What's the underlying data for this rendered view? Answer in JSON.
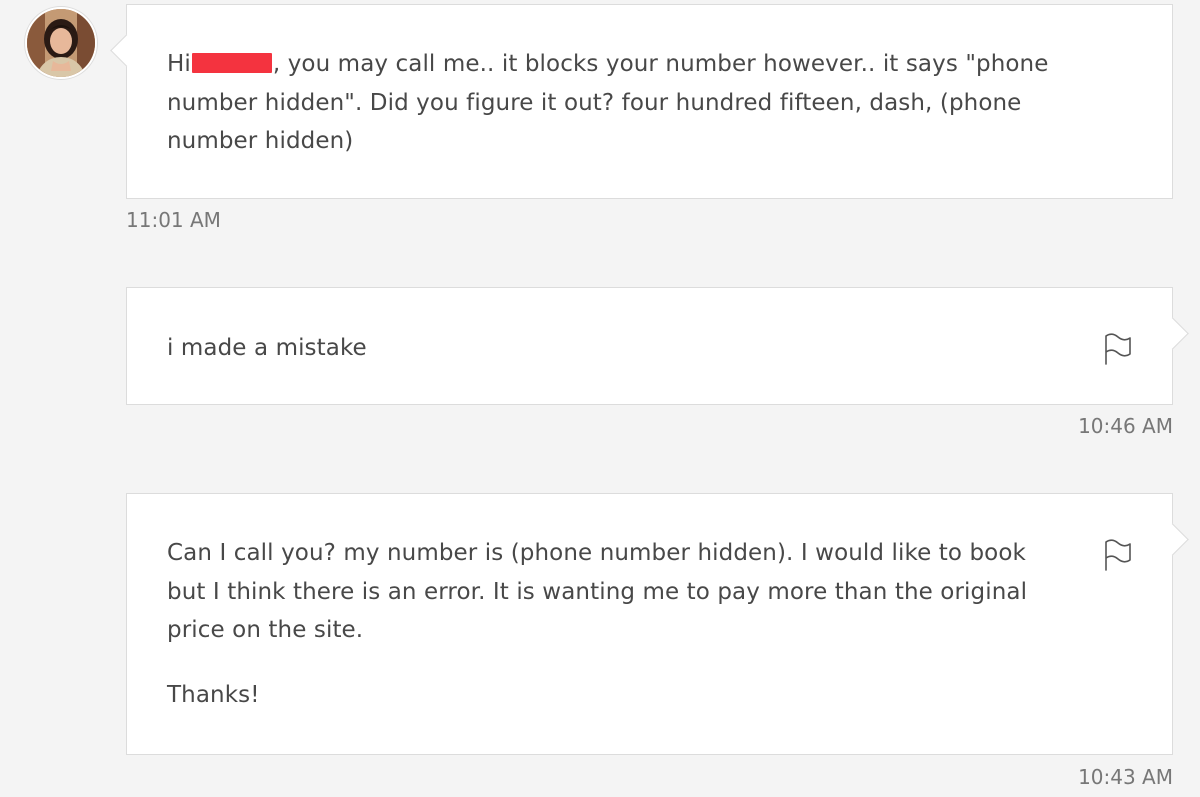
{
  "messages": [
    {
      "line1_prefix": "Hi",
      "line1_suffix": ", you may call me.. it blocks your number however.. it says \"phone",
      "line2": "number hidden\". Did you figure it out? four hundred fifteen, dash, (phone",
      "line3": "number hidden)",
      "timestamp": "11:01 AM"
    },
    {
      "line1": "i made a mistake",
      "timestamp": "10:46 AM"
    },
    {
      "line1": "Can I call you? my number is (phone number hidden). I would like to book",
      "line2": "but I think there is an error. It is wanting me to pay more than the original",
      "line3": "price on the site.",
      "line4": "Thanks!",
      "timestamp": "10:43 AM"
    }
  ],
  "icons": {
    "avatar": "host-avatar",
    "flag": "flag-icon"
  },
  "colors": {
    "background": "#f4f4f4",
    "bubble": "#ffffff",
    "border": "#dcdcdc",
    "text": "#484848",
    "timestamp": "#777777",
    "redaction": "#f4333f"
  }
}
